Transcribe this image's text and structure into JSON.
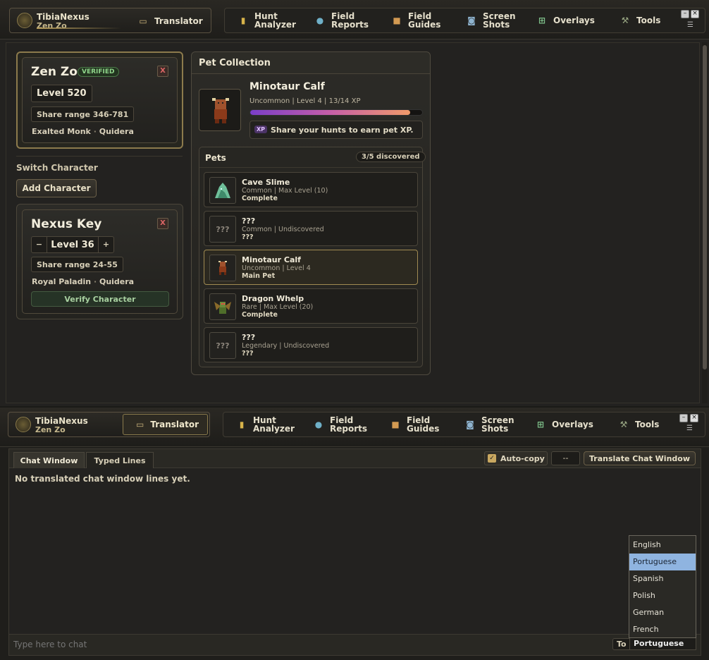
{
  "brand": {
    "app_name": "TibiaNexus",
    "character": "Zen Zo"
  },
  "nav": [
    {
      "line1": "Translator",
      "line2": "",
      "icon": "chat-icon"
    },
    {
      "line1": "Hunt",
      "line2": "Analyzer",
      "icon": "bar-chart-icon"
    },
    {
      "line1": "Field",
      "line2": "Reports",
      "icon": "globe-icon"
    },
    {
      "line1": "Field",
      "line2": "Guides",
      "icon": "book-icon"
    },
    {
      "line1": "Screen",
      "line2": "Shots",
      "icon": "camera-icon"
    },
    {
      "line1": "Overlays",
      "line2": "",
      "icon": "overlay-icon"
    },
    {
      "line1": "Tools",
      "line2": "",
      "icon": "wrench-icon"
    }
  ],
  "active_char": {
    "name": "Zen Zo",
    "badge": "VERIFIED",
    "close": "X",
    "level": "Level 520",
    "share": "Share range 346-781",
    "vocation": "Exalted Monk",
    "dot": "·",
    "world": "Quidera"
  },
  "switch": {
    "title": "Switch Character",
    "add": "Add Character"
  },
  "alt_char": {
    "name": "Nexus Key",
    "close": "X",
    "minus": "−",
    "level": "Level 36",
    "plus": "+",
    "share": "Share range 24-55",
    "vocation": "Royal Paladin",
    "dot": "·",
    "world": "Quidera",
    "verify": "Verify Character"
  },
  "pet_collection": {
    "title": "Pet Collection",
    "current": {
      "name": "Minotaur Calf",
      "meta": "Uncommon | Level 4 | 13/14 XP",
      "xp_progress": 0.93,
      "hint_badge": "XP",
      "hint": "Share your hunts to earn pet XP."
    },
    "list_title": "Pets",
    "discovered": "3/5 discovered",
    "pets": [
      {
        "name": "Cave Slime",
        "meta": "Common | Max Level (10)",
        "status": "Complete",
        "thumb": ""
      },
      {
        "name": "???",
        "meta": "Common | Undiscovered",
        "status": "???",
        "thumb": "???"
      },
      {
        "name": "Minotaur Calf",
        "meta": "Uncommon | Level 4",
        "status": "Main Pet",
        "thumb": ""
      },
      {
        "name": "Dragon Whelp",
        "meta": "Rare | Max Level (20)",
        "status": "Complete",
        "thumb": ""
      },
      {
        "name": "???",
        "meta": "Legendary | Undiscovered",
        "status": "???",
        "thumb": "???"
      }
    ]
  },
  "translator": {
    "tabs": [
      "Chat Window",
      "Typed Lines"
    ],
    "autocopy": "Auto-copy",
    "counter": "--",
    "translate_btn": "Translate Chat Window",
    "empty": "No translated chat window lines yet.",
    "input_placeholder": "Type here to chat",
    "to_label": "To",
    "selected_lang": "Portuguese",
    "languages": [
      "English",
      "Portuguese",
      "Spanish",
      "Polish",
      "German",
      "French"
    ]
  },
  "colors": {
    "accent_gold": "#8c7a4c",
    "verified_green": "#6fae6a",
    "xp_bar": "#e07a6a",
    "dropdown_highlight": "#8fb4e0"
  }
}
